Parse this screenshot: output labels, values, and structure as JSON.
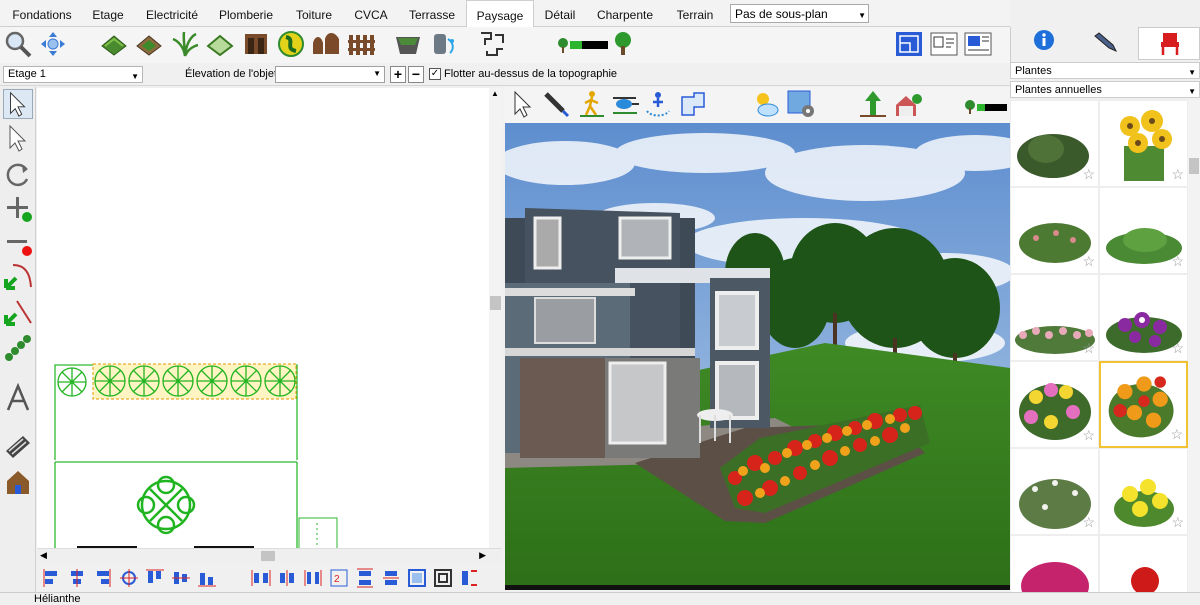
{
  "tabs": [
    "Fondations",
    "Etage",
    "Electricité",
    "Plomberie",
    "Toiture",
    "CVCA",
    "Terrasse",
    "Paysage",
    "Détail",
    "Charpente",
    "Terrain"
  ],
  "active_tab": "Paysage",
  "floor_plan_select": "Pas de sous-plan",
  "options": {
    "level": "Etage 1",
    "elevation_label": "Élevation de l'objet:",
    "elevation_value": "",
    "plus": "+",
    "minus": "−",
    "float_checked": "✓",
    "float_label": "Flotter au-dessus de la topographie"
  },
  "right_panel": {
    "category": "Plantes",
    "subcategory": "Plantes annuelles"
  },
  "status": "Hélianthe",
  "colors": {
    "accent_blue": "#1e6fd9",
    "plant_green": "#2e8b2e",
    "selection": "#f1c232"
  }
}
